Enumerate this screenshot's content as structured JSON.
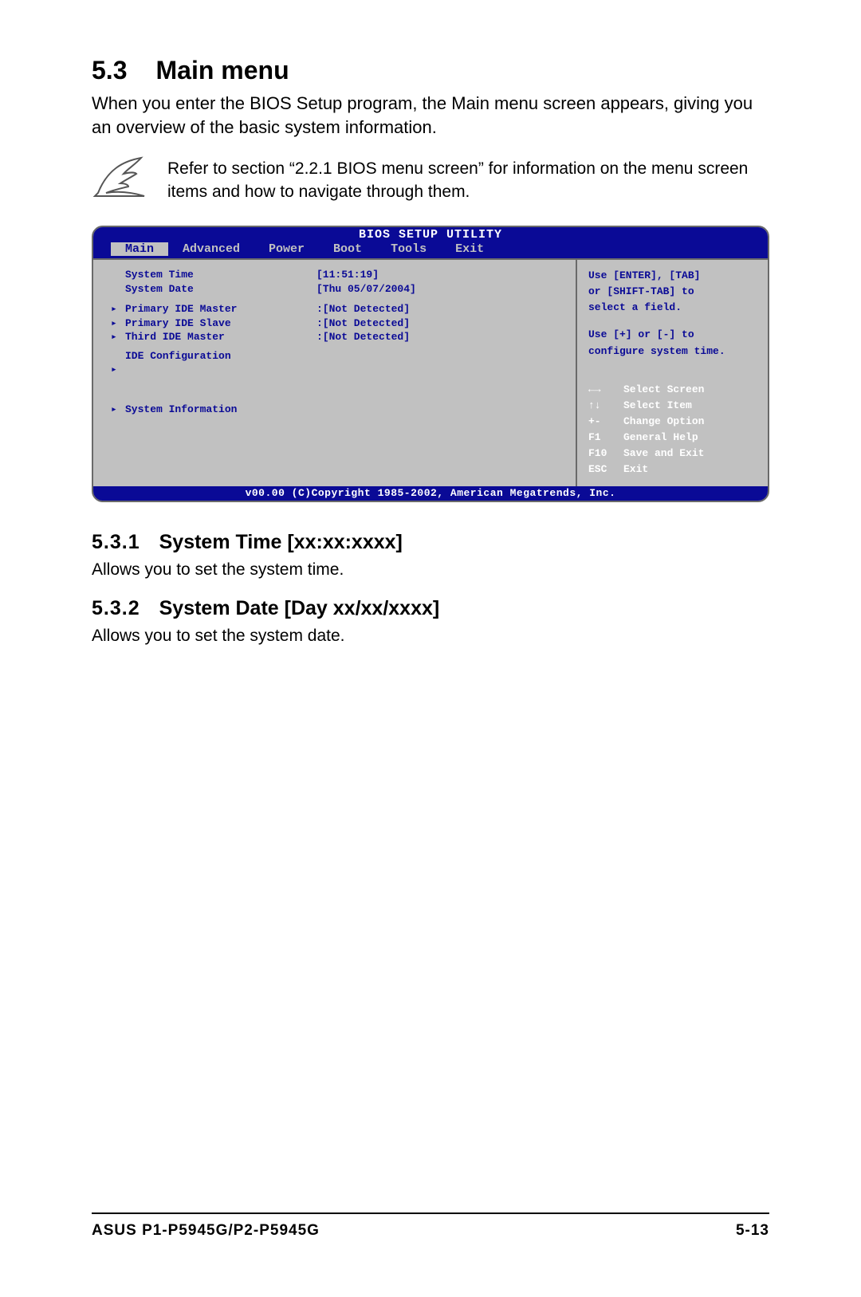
{
  "section": {
    "num": "5.3",
    "title": "Main menu"
  },
  "intro": "When you enter the BIOS Setup program, the Main menu screen appears, giving you an overview of the basic system information.",
  "note": "Refer to section “2.2.1  BIOS menu screen” for information on the menu screen items and how to navigate through them.",
  "bios": {
    "title": "BIOS SETUP UTILITY",
    "tabs": {
      "t0": "Main",
      "t1": "Advanced",
      "t2": "Power",
      "t3": "Boot",
      "t4": "Tools",
      "t5": "Exit"
    },
    "rows": {
      "time_label": "System Time",
      "time_value": "[11:51:19]",
      "date_label": "System Date",
      "date_value": "[Thu 05/07/2004]",
      "pim_label": "Primary IDE Master",
      "pim_value": ":[Not Detected]",
      "pis_label": "Primary IDE Slave",
      "pis_value": ":[Not Detected]",
      "tim_label": "Third IDE Master",
      "tim_value": ":[Not Detected]",
      "idecfg_label": "IDE Configuration",
      "sysinfo_label": "System Information"
    },
    "help": {
      "l1": "Use [ENTER], [TAB]",
      "l2": "or [SHIFT-TAB] to",
      "l3": "select a field.",
      "l4": "Use [+] or [-] to",
      "l5": "configure system time."
    },
    "nav": {
      "r1k": "←→",
      "r1v": "Select Screen",
      "r2k": "↑↓",
      "r2v": "Select Item",
      "r3k": "+-",
      "r3v": "Change Option",
      "r4k": "F1",
      "r4v": "General Help",
      "r5k": "F10",
      "r5v": "Save and Exit",
      "r6k": "ESC",
      "r6v": "Exit"
    },
    "copyright": "v00.00 (C)Copyright 1985-2002, American Megatrends, Inc."
  },
  "sub1": {
    "num": "5.3.1",
    "title": "System Time [xx:xx:xxxx]",
    "desc": "Allows you to set the system time."
  },
  "sub2": {
    "num": "5.3.2",
    "title": "System Date [Day xx/xx/xxxx]",
    "desc": "Allows you to set the system date."
  },
  "footer": {
    "left": "ASUS P1-P5945G/P2-P5945G",
    "right": "5-13"
  }
}
